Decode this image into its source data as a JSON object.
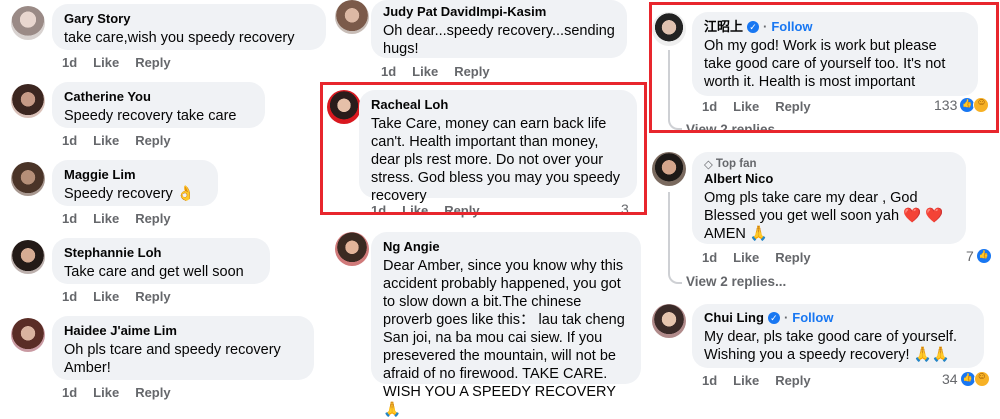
{
  "actions": {
    "like": "Like",
    "reply": "Reply"
  },
  "col1": [
    {
      "author": "Gary Story",
      "text": "take care,wish you speedy recovery",
      "age": "1d"
    },
    {
      "author": "Catherine You",
      "text": "Speedy recovery take care",
      "age": "1d"
    },
    {
      "author": "Maggie Lim",
      "text": "Speedy recovery 👌",
      "age": "1d"
    },
    {
      "author": "Stephannie Loh",
      "text": "Take care and get well soon",
      "age": "1d"
    },
    {
      "author": "Haidee J'aime Lim",
      "text": "Oh pls tcare and speedy recovery Amber!",
      "age": "1d"
    }
  ],
  "col2": [
    {
      "author": "Judy Pat DavidImpi-Kasim",
      "text": "Oh dear...speedy recovery...sending hugs!",
      "age": "1d"
    },
    {
      "author": "Racheal Loh",
      "text": "Take Care, money can earn back life can't. Health important than money, dear pls rest more. Do not over your stress. God bless you may you speedy recovery",
      "age": "1d",
      "reactions": "3"
    },
    {
      "author": "Ng Angie",
      "text": "Dear Amber, since you know why this accident probably happened, you got to slow down a bit.The chinese proverb goes like this： lau tak cheng San joi, na ba mou cai siew.  If you presevered the mountain,  will not be afraid of no firewood. TAKE CARE. WISH YOU A SPEEDY RECOVERY 🙏"
    }
  ],
  "col3": [
    {
      "author": "江昭上",
      "follow": "Follow",
      "text": "Oh my god! Work is work but please take good care of yourself too. It's not worth it. Health is most important",
      "age": "1d",
      "reactions": "133",
      "replies": "View 2 replies..."
    },
    {
      "badge": "Top fan",
      "author": "Albert Nico",
      "text": "Omg pls take care my dear , God Blessed you get well soon yah ❤️ ❤️ AMEN 🙏",
      "age": "1d",
      "reactions": "7",
      "replies": "View 2 replies..."
    },
    {
      "author": "Chui Ling",
      "follow": "Follow",
      "text": "My dear, pls take good care of yourself. Wishing you a speedy recovery! 🙏🙏",
      "age": "1d",
      "reactions": "34"
    }
  ],
  "colors": {
    "highlight": "#e8262d",
    "like_blue": "#1877f2",
    "bubble_bg": "#f0f2f5"
  }
}
